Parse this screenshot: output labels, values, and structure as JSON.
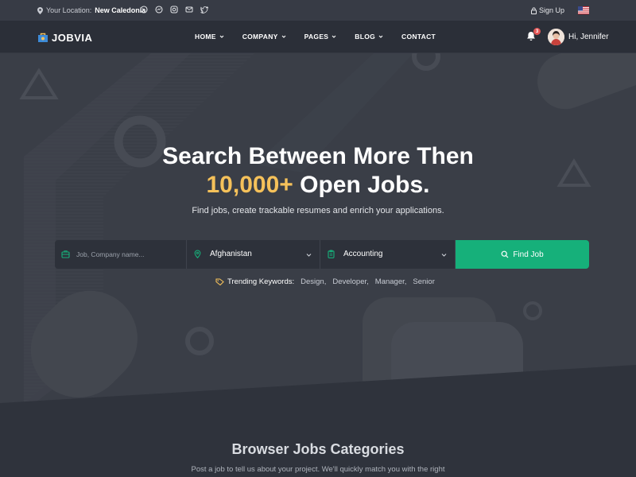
{
  "topbar": {
    "location_label": "Your Location:",
    "location_value": "New Caledonia",
    "signup": "Sign Up"
  },
  "nav": {
    "brand": "JOBVIA",
    "links": [
      {
        "label": "HOME",
        "dropdown": true
      },
      {
        "label": "COMPANY",
        "dropdown": true
      },
      {
        "label": "PAGES",
        "dropdown": true
      },
      {
        "label": "BLOG",
        "dropdown": true
      },
      {
        "label": "CONTACT",
        "dropdown": false
      }
    ],
    "notification_count": "3",
    "greeting": "Hi, Jennifer"
  },
  "hero": {
    "title_line1": "Search Between More Then",
    "title_highlight": "10,000+",
    "title_line2_rest": " Open Jobs.",
    "subtitle": "Find jobs, create trackable resumes and enrich your applications."
  },
  "search": {
    "keyword_placeholder": "Job, Company name...",
    "location_value": "Afghanistan",
    "category_value": "Accounting",
    "button": "Find Job"
  },
  "trending": {
    "label": "Trending Keywords:",
    "keywords": [
      "Design,",
      "Developer,",
      "Manager,",
      "Senior"
    ]
  },
  "categories": {
    "title": "Browser Jobs Categories",
    "subtitle": "Post a job to tell us about your project. We'll quickly match you with the right"
  },
  "colors": {
    "accent": "#16b07a",
    "highlight": "#f5c15a",
    "badge": "#e35656"
  }
}
